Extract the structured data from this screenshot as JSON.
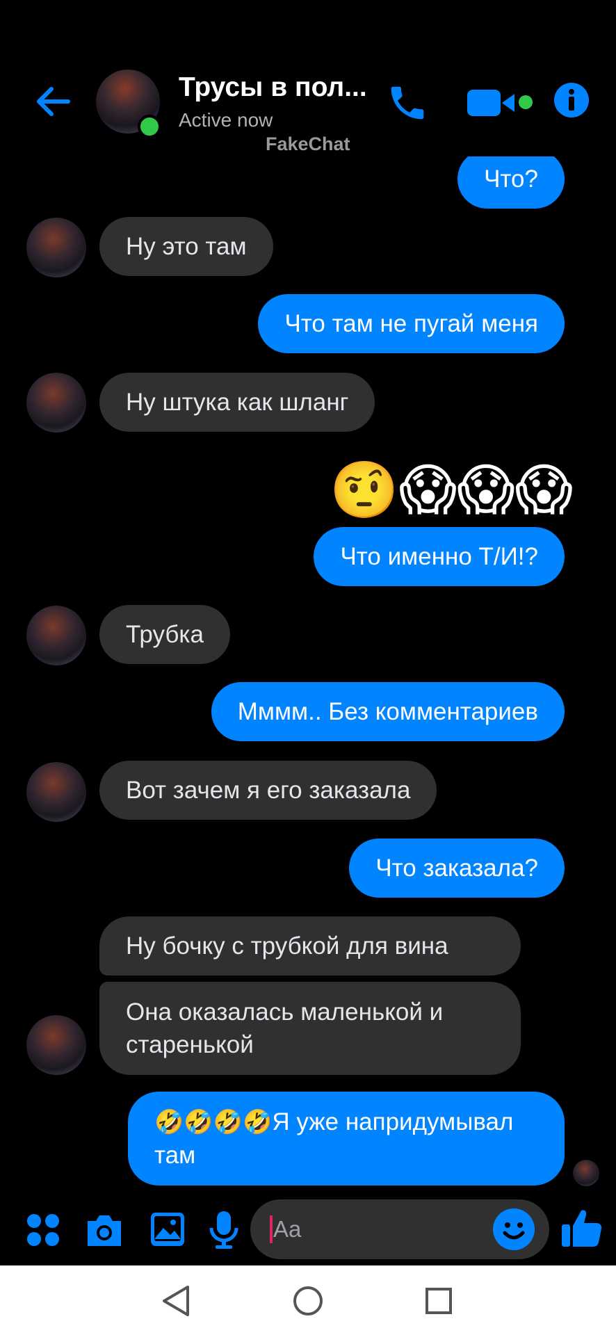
{
  "header": {
    "back_icon": "arrow-left-icon",
    "contact_name": "Трусы в пол...",
    "status": "Active now",
    "watermark": "FakeChat",
    "call_icon": "phone-icon",
    "video_icon": "video-camera-icon",
    "info_icon": "info-icon",
    "accent_color": "#0084ff",
    "online_color": "#31c94a"
  },
  "messages": [
    {
      "dir": "out",
      "text": "Что?"
    },
    {
      "dir": "in",
      "text": "Ну это там"
    },
    {
      "dir": "out",
      "text": "Что там не пугай меня"
    },
    {
      "dir": "in",
      "text": "Ну штука как шланг"
    },
    {
      "dir": "out",
      "emoji": "🤨😱😱😱"
    },
    {
      "dir": "out",
      "text": "Что именно Т/И!?"
    },
    {
      "dir": "in",
      "text": "Трубка"
    },
    {
      "dir": "out",
      "text": "Мммм.. Без комментариев"
    },
    {
      "dir": "in",
      "text": "Вот зачем я его заказала"
    },
    {
      "dir": "out",
      "text": "Что заказала?"
    },
    {
      "dir": "in",
      "text": "Ну бочку с трубкой для вина"
    },
    {
      "dir": "in",
      "text": "Она оказалась маленькой и старенькой"
    },
    {
      "dir": "out",
      "emoji_prefix": "🤣🤣🤣🤣",
      "text": "Я уже напридумывал там"
    }
  ],
  "composer": {
    "menu_icon": "four-dots-icon",
    "camera_icon": "camera-icon",
    "gallery_icon": "image-icon",
    "mic_icon": "microphone-icon",
    "placeholder": "Aa",
    "emoji_icon": "smiley-icon",
    "like_icon": "thumbs-up-icon"
  },
  "navbar": {
    "back_icon": "triangle-back-icon",
    "home_icon": "circle-home-icon",
    "recents_icon": "square-recents-icon"
  }
}
